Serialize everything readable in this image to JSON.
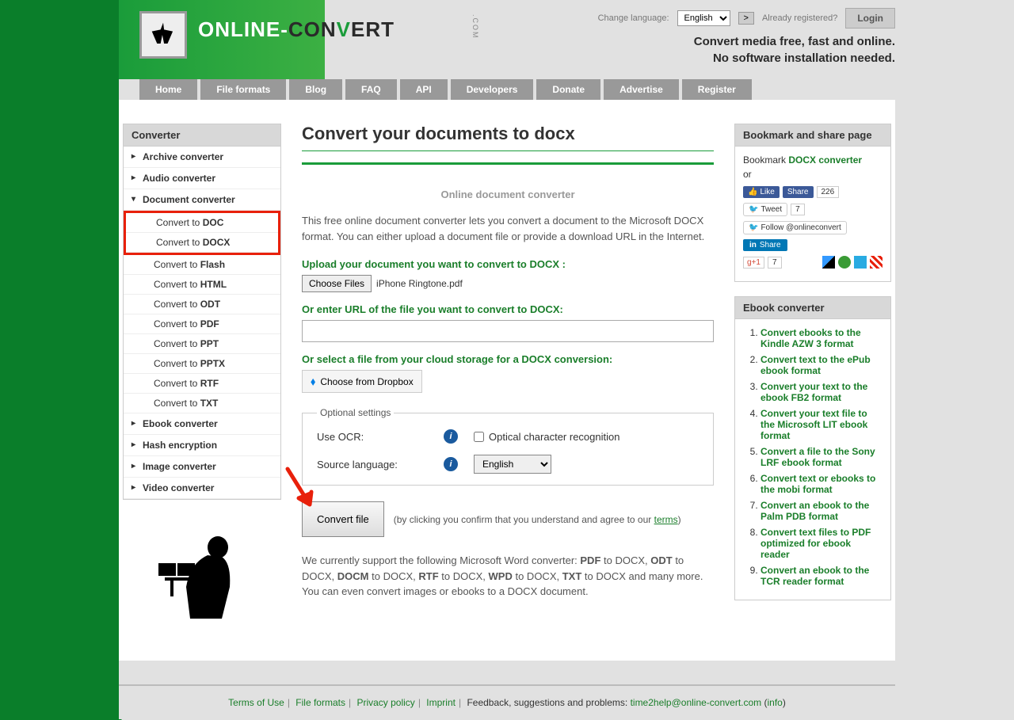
{
  "header": {
    "change_lang_label": "Change language:",
    "lang_value": "English",
    "go": ">",
    "registered_label": "Already registered?",
    "login": "Login",
    "tagline1": "Convert media free, fast and online.",
    "tagline2": "No software installation needed.",
    "logo_online": "ONLINE-",
    "logo_con": "CON",
    "logo_v": "V",
    "logo_ert": "ERT",
    "logo_com": ".COM"
  },
  "nav": [
    "Home",
    "File formats",
    "Blog",
    "FAQ",
    "API",
    "Developers",
    "Donate",
    "Advertise",
    "Register"
  ],
  "sidebar": {
    "title": "Converter",
    "items": [
      {
        "label": "Archive converter",
        "expanded": false
      },
      {
        "label": "Audio converter",
        "expanded": false
      },
      {
        "label": "Document converter",
        "expanded": true,
        "subs": [
          {
            "prefix": "Convert to ",
            "fmt": "DOC",
            "hl": true
          },
          {
            "prefix": "Convert to ",
            "fmt": "DOCX",
            "hl": true
          },
          {
            "prefix": "Convert to ",
            "fmt": "Flash"
          },
          {
            "prefix": "Convert to ",
            "fmt": "HTML"
          },
          {
            "prefix": "Convert to ",
            "fmt": "ODT"
          },
          {
            "prefix": "Convert to ",
            "fmt": "PDF"
          },
          {
            "prefix": "Convert to ",
            "fmt": "PPT"
          },
          {
            "prefix": "Convert to ",
            "fmt": "PPTX"
          },
          {
            "prefix": "Convert to ",
            "fmt": "RTF"
          },
          {
            "prefix": "Convert to ",
            "fmt": "TXT"
          }
        ]
      },
      {
        "label": "Ebook converter",
        "expanded": false
      },
      {
        "label": "Hash encryption",
        "expanded": false
      },
      {
        "label": "Image converter",
        "expanded": false
      },
      {
        "label": "Video converter",
        "expanded": false
      }
    ]
  },
  "main": {
    "title": "Convert your documents to docx",
    "subtitle": "Online document converter",
    "desc": "This free online document converter lets you convert a document to the Microsoft DOCX format. You can either upload a document file or provide a download URL in the Internet.",
    "upload_label": "Upload your document you want to convert to DOCX :",
    "choose_files": "Choose Files",
    "file_name": "iPhone Ringtone.pdf",
    "url_label": "Or enter URL of the file you want to convert to DOCX:",
    "cloud_label": "Or select a file from your cloud storage for a DOCX conversion:",
    "dropbox": "Choose from Dropbox",
    "optional_legend": "Optional settings",
    "ocr_label": "Use OCR:",
    "ocr_check": "Optical character recognition",
    "srclang_label": "Source language:",
    "srclang_value": "English",
    "convert_btn": "Convert file",
    "convert_note_1": "(by clicking you confirm that you understand and agree to our ",
    "convert_terms": "terms",
    "convert_note_2": ")",
    "support_html": "We currently support the following Microsoft Word converter: <b>PDF</b> to DOCX, <b>ODT</b> to DOCX, <b>DOCM</b> to DOCX, <b>RTF</b> to DOCX, <b>WPD</b> to DOCX, <b>TXT</b> to DOCX and many more. You can even convert images or ebooks to a DOCX document."
  },
  "right": {
    "bookmark_title": "Bookmark and share page",
    "bookmark_pre": "Bookmark ",
    "bookmark_link": "DOCX converter",
    "or": "or",
    "fb_like": "Like",
    "fb_share": "Share",
    "fb_count": "226",
    "tweet": "Tweet",
    "tweet_count": "7",
    "follow": "Follow @onlineconvert",
    "in_share": "Share",
    "gplus": "g+1",
    "gplus_count": "7",
    "ebook_title": "Ebook converter",
    "ebook_items": [
      "Convert ebooks to the Kindle AZW 3 format",
      "Convert text to the ePub ebook format",
      "Convert your text to the ebook FB2 format",
      "Convert your text file to the Microsoft LIT ebook format",
      "Convert a file to the Sony LRF ebook format",
      "Convert text or ebooks to the mobi format",
      "Convert an ebook to the Palm PDB format",
      "Convert text files to PDF optimized for ebook reader",
      "Convert an ebook to the TCR reader format"
    ]
  },
  "footer": {
    "terms": "Terms of Use",
    "formats": "File formats",
    "privacy": "Privacy policy",
    "imprint": "Imprint",
    "feedback_pre": "Feedback, suggestions and problems: ",
    "email": "time2help@online-convert.com",
    "info": "info"
  }
}
